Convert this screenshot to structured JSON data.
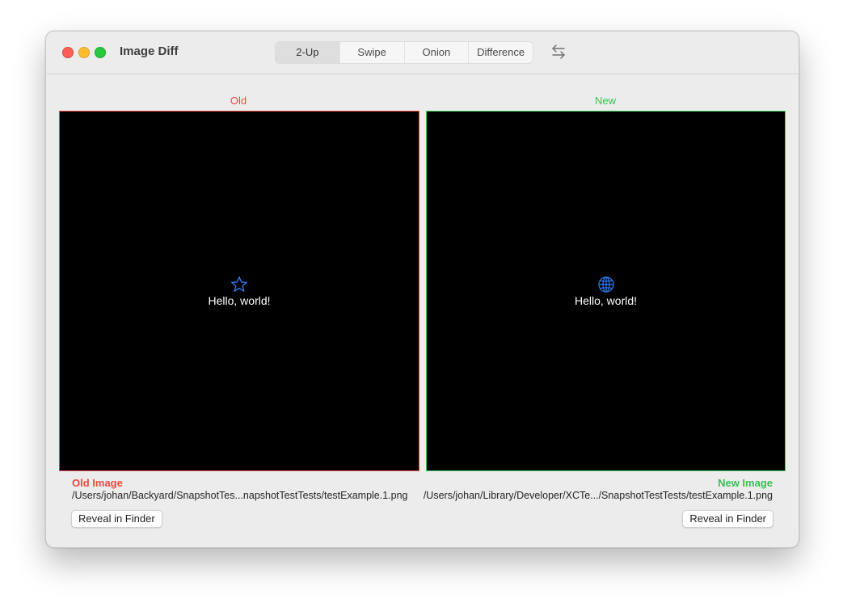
{
  "window": {
    "title": "Image Diff"
  },
  "toolbar": {
    "modes": [
      {
        "label": "2-Up",
        "selected": true
      },
      {
        "label": "Swipe",
        "selected": false
      },
      {
        "label": "Onion",
        "selected": false
      },
      {
        "label": "Difference",
        "selected": false
      }
    ],
    "swap_icon": "swap-arrows-icon"
  },
  "old": {
    "header": "Old",
    "image_text": "Hello, world!",
    "image_icon": "star-icon",
    "caption": "Old Image",
    "path": "/Users/johan/Backyard/SnapshotTes...napshotTestTests/testExample.1.png",
    "reveal_label": "Reveal in Finder",
    "color": "#ee4a40"
  },
  "new": {
    "header": "New",
    "image_text": "Hello, world!",
    "image_icon": "globe-icon",
    "caption": "New Image",
    "path": "/Users/johan/Library/Developer/XCTe.../SnapshotTestTests/testExample.1.png",
    "reveal_label": "Reveal in Finder",
    "color": "#36c152"
  },
  "colors": {
    "icon_blue": "#2f7df6",
    "close": "#fe5f57",
    "minimize": "#febc2e",
    "maximize": "#28c840"
  }
}
